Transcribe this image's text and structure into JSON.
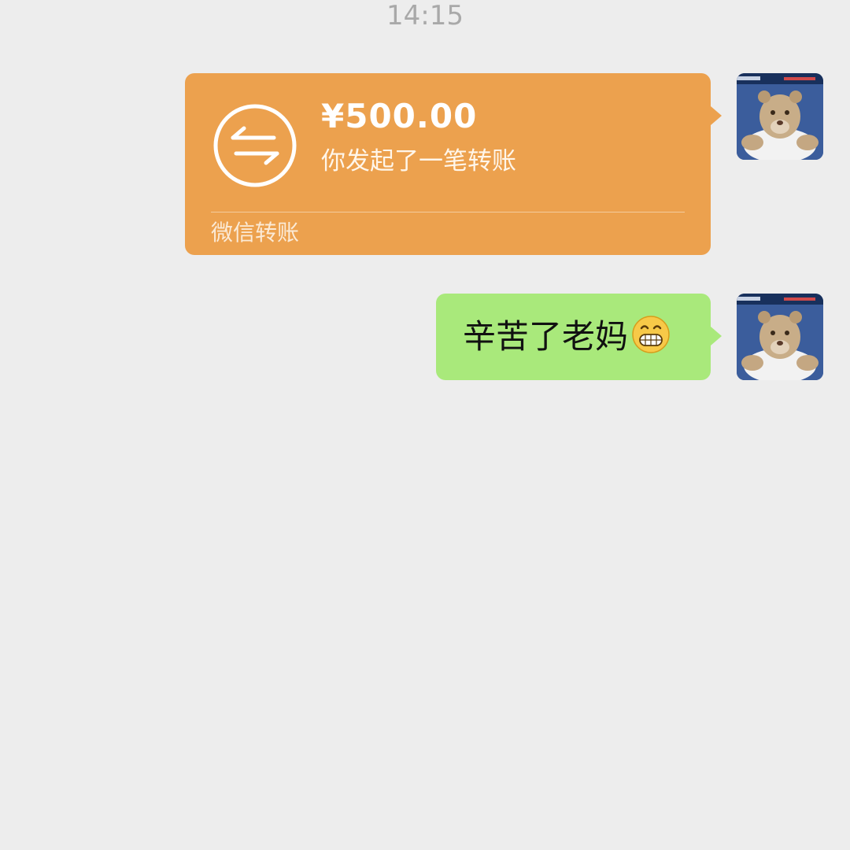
{
  "chat": {
    "timestamp": "14:15",
    "transfer": {
      "amount": "¥500.00",
      "description": "你发起了一笔转账",
      "footer": "微信转账",
      "icon": "transfer-arrows-icon",
      "bubble_color": "#eca14e"
    },
    "text_message": {
      "text": "辛苦了老妈",
      "emoji": "grinning-face-emoji",
      "bubble_color": "#a9e97b"
    },
    "sender_avatar": "lion-cub-avatar"
  }
}
